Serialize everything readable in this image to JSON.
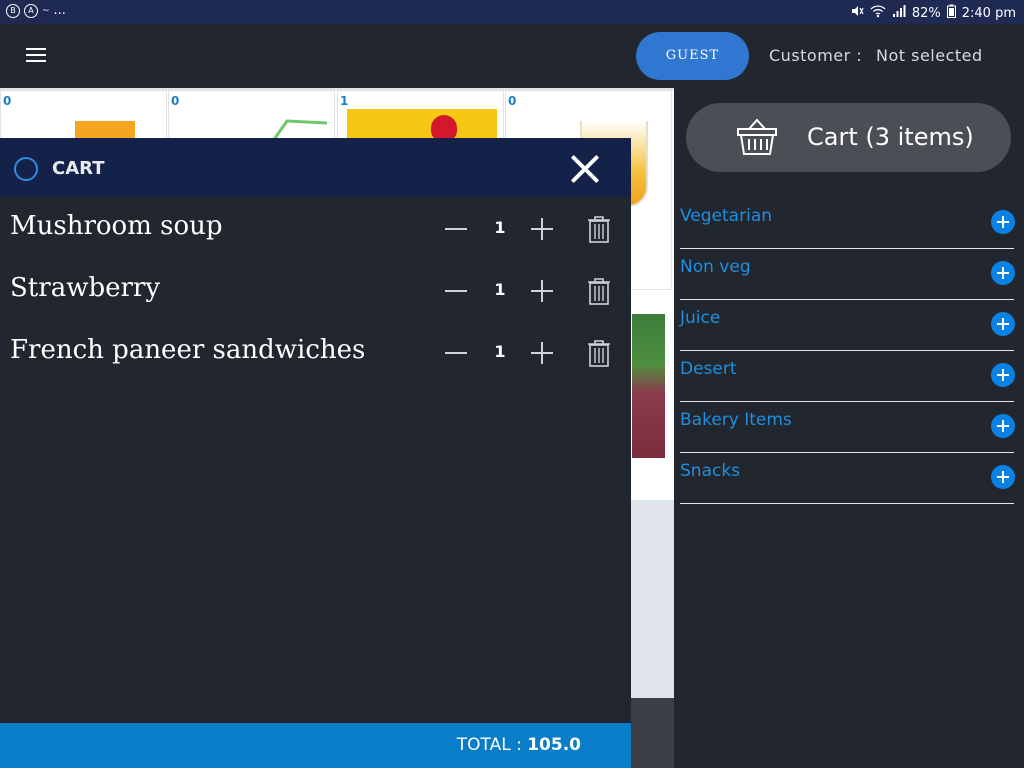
{
  "status_bar": {
    "icons_left": [
      "b-circle-icon",
      "a-circle-icon",
      "notification-icon"
    ],
    "more": "...",
    "battery": "82%",
    "time": "2:40 pm"
  },
  "header": {
    "guest_label": "GUEST",
    "customer_label": "Customer :",
    "customer_value": "Not selected"
  },
  "products": {
    "tile_quantities": [
      "0",
      "0",
      "1",
      "0"
    ]
  },
  "cart": {
    "title": "CART",
    "items": [
      {
        "name": "Mushroom soup",
        "qty": "1"
      },
      {
        "name": "Strawberry",
        "qty": "1"
      },
      {
        "name": "French paneer sandwiches",
        "qty": "1"
      }
    ],
    "total_label": "TOTAL :",
    "total_value": "105.0"
  },
  "sidebar": {
    "cart_button": "Cart (3 items)",
    "categories": [
      "Vegetarian",
      "Non veg",
      "Juice",
      "Desert",
      "Bakery Items",
      "Snacks"
    ]
  },
  "colors": {
    "accent_blue": "#0a82e3",
    "header_navy": "#142249",
    "total_bar": "#0a7dc9",
    "background": "#22262e"
  }
}
